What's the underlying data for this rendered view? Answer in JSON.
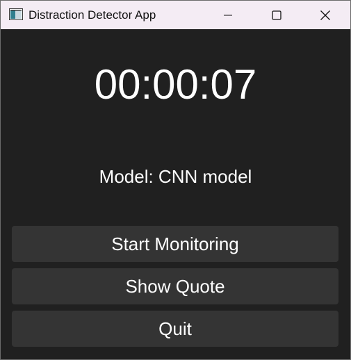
{
  "window": {
    "title": "Distraction Detector App",
    "icon": "app-icon"
  },
  "titlebar_controls": {
    "minimize": "minimize-icon",
    "maximize": "maximize-icon",
    "close": "close-icon"
  },
  "main": {
    "timer": "00:00:07",
    "model_label": "Model: CNN model"
  },
  "buttons": {
    "start": "Start Monitoring",
    "quote": "Show Quote",
    "quit": "Quit"
  },
  "colors": {
    "background": "#202020",
    "button": "#343434",
    "titlebar": "#f4ecf4",
    "text": "#ffffff"
  }
}
